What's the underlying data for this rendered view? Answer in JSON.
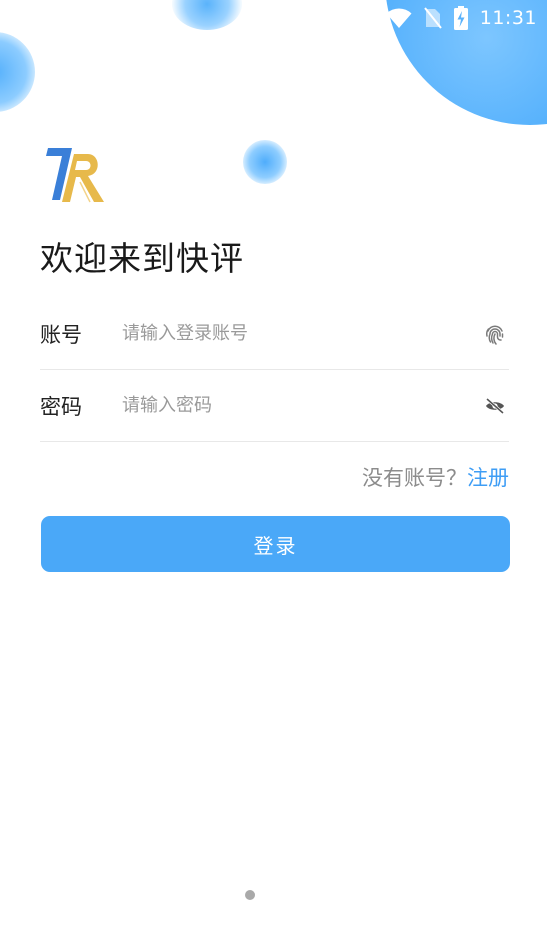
{
  "status_bar": {
    "time": "11:31",
    "icons": [
      "wifi-icon",
      "no-sim-icon",
      "battery-charging-icon"
    ]
  },
  "brand": {
    "logo_icon": "app-logo-7r",
    "colors": {
      "blue": "#3a7fd8",
      "gold": "#e7b94b"
    }
  },
  "welcome_title": "欢迎来到快评",
  "form": {
    "account": {
      "label": "账号",
      "placeholder": "请输入登录账号",
      "value": "",
      "icon": "fingerprint-icon"
    },
    "password": {
      "label": "密码",
      "placeholder": "请输入密码",
      "value": "",
      "icon": "eye-off-icon"
    }
  },
  "register": {
    "prompt": "没有账号？",
    "link": "注册"
  },
  "login_button": "登录",
  "theme": {
    "accent": "#4aa8f8",
    "link": "#3e9df5"
  }
}
